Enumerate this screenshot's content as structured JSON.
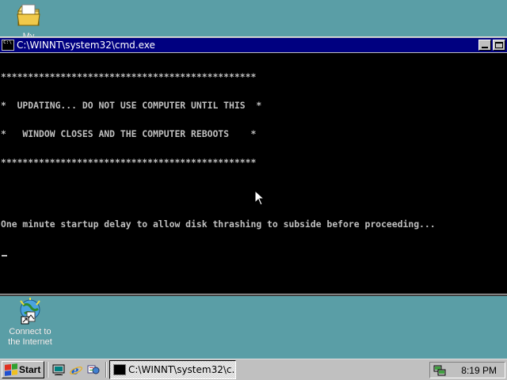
{
  "desktop": {
    "icons": [
      {
        "label": "My Documents",
        "icon": "folder-icon"
      },
      {
        "label_line1": "Connect to",
        "label_line2": "the Internet",
        "icon": "connect-internet-icon"
      }
    ]
  },
  "window": {
    "title": "C:\\WINNT\\system32\\cmd.exe",
    "console_lines": [
      "***********************************************",
      "*  UPDATING... DO NOT USE COMPUTER UNTIL THIS  *",
      "*   WINDOW CLOSES AND THE COMPUTER REBOOTS    *",
      "***********************************************",
      "One minute startup delay to allow disk thrashing to subside before proceeding..."
    ]
  },
  "taskbar": {
    "start_label": "Start",
    "quick_launch": [
      "desktop-icon",
      "ie-icon",
      "channels-icon"
    ],
    "tasks": [
      {
        "label": "C:\\WINNT\\system32\\c...",
        "icon": "cmd-icon"
      }
    ],
    "clock": "8:19 PM",
    "tray_icons": [
      "network-tray-icon"
    ]
  },
  "colors": {
    "desktop": "#5a9ea6",
    "titlebar": "#000080",
    "console_bg": "#000000",
    "console_fg": "#c0c0c0"
  }
}
